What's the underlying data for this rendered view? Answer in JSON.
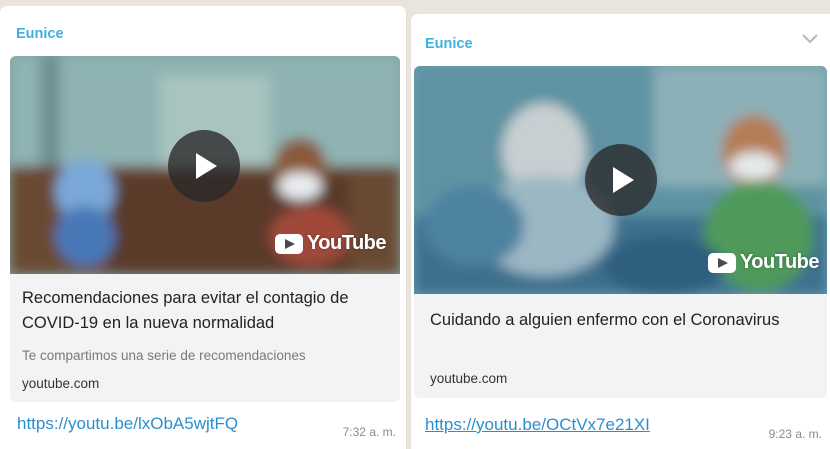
{
  "messages": [
    {
      "sender": "Eunice",
      "preview": {
        "title": "Recomendaciones para evitar el contagio de COVID-19 en la nueva normalidad",
        "description": "Te compartimos una serie de recomendaciones",
        "domain": "youtube.com",
        "brand": "YouTube"
      },
      "link": "https://youtu.be/lxObA5wjtFQ",
      "time": "7:32 a. m."
    },
    {
      "sender": "Eunice",
      "preview": {
        "title": "Cuidando a alguien enfermo con el Coronavirus",
        "domain": "youtube.com",
        "brand": "YouTube"
      },
      "link": "https://youtu.be/OCtVx7e21XI",
      "time": "9:23 a. m."
    }
  ],
  "icons": {
    "play": "play-icon",
    "youtube": "youtube-logo-icon",
    "menu": "chevron-down-icon"
  },
  "colors": {
    "sender": "#3fb0e0",
    "link": "#2a8fd0",
    "bubble": "#ffffff",
    "background": "#e9e4dd"
  }
}
